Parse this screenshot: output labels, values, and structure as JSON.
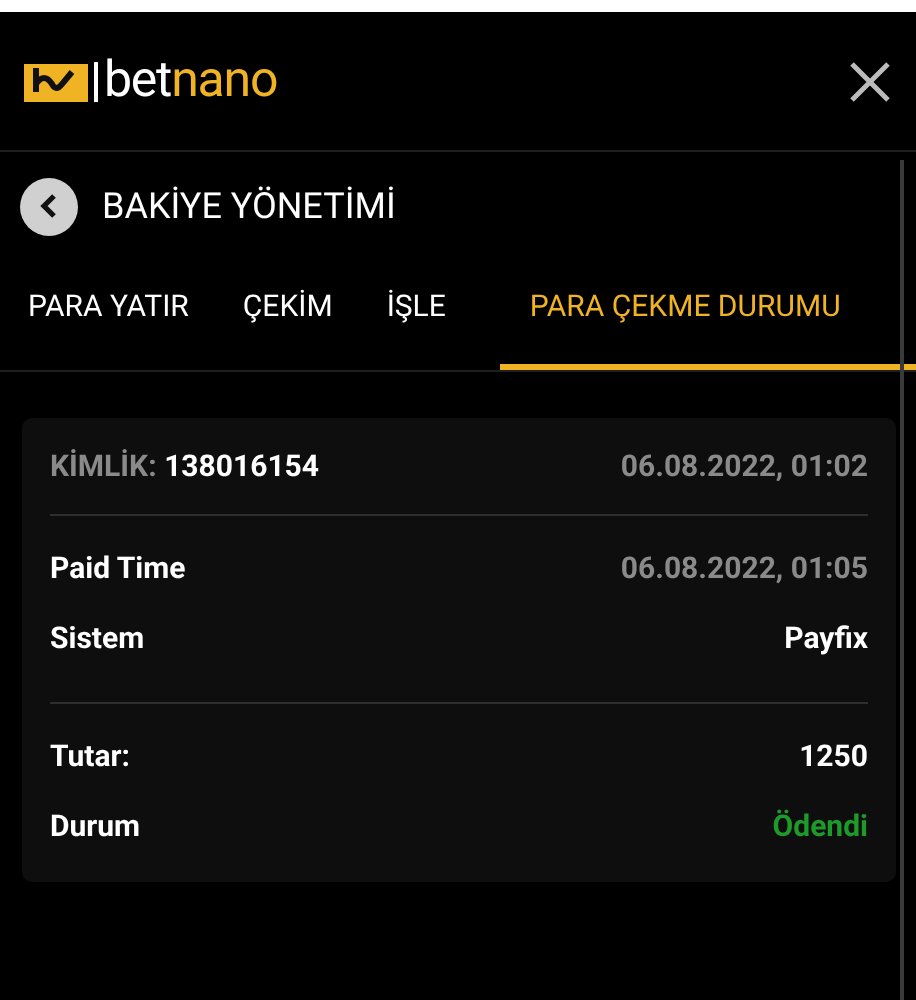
{
  "header": {
    "logo": {
      "part_1": "bet",
      "part_2": "nano"
    }
  },
  "page": {
    "title": "BAKİYE YÖNETİMİ"
  },
  "tabs": [
    {
      "label": "PARA YATIR",
      "selected": false
    },
    {
      "label": "ÇEKİM",
      "selected": false
    },
    {
      "label": "İŞLE",
      "selected": false
    },
    {
      "label": "PARA ÇEKME DURUMU",
      "selected": true
    }
  ],
  "card": {
    "id_label": "KİMLİK:",
    "id": "138016154",
    "date": "06.08.2022, 01:02",
    "sections": [
      [
        {
          "label": "Paid Time",
          "value": "06.08.2022, 01:05",
          "kind": "date"
        },
        {
          "label": "Sistem",
          "value": "Payfix",
          "kind": "text"
        }
      ],
      [
        {
          "label": "Tutar:",
          "value": "1250",
          "kind": "text"
        },
        {
          "label": "Durum",
          "value": "Ödendi",
          "kind": "status"
        }
      ]
    ]
  }
}
